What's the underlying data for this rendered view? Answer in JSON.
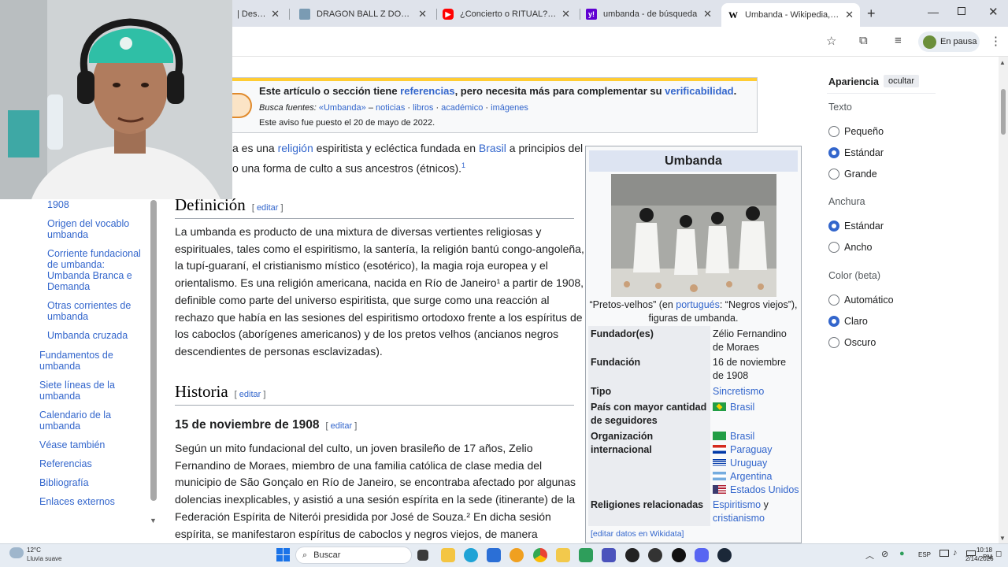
{
  "browser": {
    "tabs": [
      {
        "title": "| Descarg",
        "favicon_color": "#777777"
      },
      {
        "title": "DRAGON BALL Z DOKKAN",
        "favicon_color": "#7a9bb3"
      },
      {
        "title": "¿Concierto o RITUAL? Las s",
        "favicon_color": "#ff0000"
      },
      {
        "title": "umbanda - de búsqueda",
        "favicon_color": "#6001d2",
        "favicon_letter": "y!"
      },
      {
        "title": "Umbanda - Wikipedia, la e",
        "favicon_color": "#000000",
        "favicon_letter": "W"
      }
    ],
    "new_tab": "+",
    "profile_status": "En pausa"
  },
  "notice": {
    "line1_a": "Este artículo o sección tiene ",
    "line1_link1": "referencias",
    "line1_b": ", pero necesita más para complementar su ",
    "line1_link2": "verificabilidad",
    "line1_c": ".",
    "line2_prefix": "Busca fuentes:",
    "line2_links": [
      "«Umbanda»",
      "noticias",
      "libros",
      "académico",
      "imágenes"
    ],
    "line3": "Este aviso fue puesto el 20 de mayo de 2022."
  },
  "toc": {
    "items": [
      {
        "label": "1908"
      },
      {
        "label": "Origen del vocablo umbanda"
      },
      {
        "label": "Corriente fundacional de umbanda: Umbanda Branca e Demanda"
      },
      {
        "label": "Otras corrientes de umbanda"
      },
      {
        "label": "Umbanda cruzada"
      },
      {
        "label": "Fundamentos de umbanda"
      },
      {
        "label": "Siete líneas de la umbanda"
      },
      {
        "label": "Calendario de la umbanda"
      },
      {
        "label": "Véase también"
      },
      {
        "label": "Referencias"
      },
      {
        "label": "Bibliografía"
      },
      {
        "label": "Enlaces externos"
      }
    ]
  },
  "article": {
    "intro_l1_a": "a es una ",
    "intro_l1_link1": "religión",
    "intro_l1_b": " espiritista y ecléctica fundada en ",
    "intro_l1_link2": "Brasil",
    "intro_l1_c": " a principios del",
    "intro_l2": "o una forma de culto a sus ancestros (étnicos).",
    "intro_sup": "1",
    "h_definicion": "Definición",
    "edit": "editar",
    "def_lines": [
      "La umbanda es producto de una mixtura de diversas vertientes religiosas y",
      "espirituales, tales como el espiritismo, la santería, la religión bantú congo-angoleña,",
      "la tupí-guaraní, el cristianismo místico (esotérico), la magia roja europea y el",
      "orientalismo. Es una religión americana, nacida en Río de Janeiro¹  a partir de 1908,",
      "definible como parte del universo espiritista, que surge como una reacción al",
      "rechazo que había en las sesiones del espiritismo ortodoxo frente a los espíritus de",
      "los caboclos (aborígenes americanos) y de los pretos velhos (ancianos negros",
      "descendientes de personas esclavizadas)."
    ],
    "h_historia": "Historia",
    "h_fecha": "15 de noviembre de 1908",
    "hist_lines": [
      "Según un mito fundacional del culto, un joven brasileño de 17 años, Zelio",
      "Fernandino de Moraes, miembro de una familia católica de clase media del",
      "municipio de São Gonçalo en Río de Janeiro, se encontraba afectado por algunas",
      "dolencias inexplicables, y asistió a una sesión espírita en la sede (itinerante) de la",
      "Federación Espírita de Niterói presidida por José de Souza.²  En dicha sesión",
      "espírita, se manifestaron espíritus de caboclos y negros viejos, de manera"
    ]
  },
  "infobox": {
    "title": "Umbanda",
    "caption_a": "“Pretos-velhos” (en ",
    "caption_link": "portugués",
    "caption_b": ": “Negros viejos”),",
    "caption_c": "figuras de umbanda.",
    "rows": [
      {
        "label": "Fundador(es)",
        "value": "Zélio Fernandino de Moraes"
      },
      {
        "label": "Fundación",
        "value": "16 de noviembre de 1908"
      },
      {
        "label": "Tipo",
        "value": "Sincretismo"
      },
      {
        "label": "País con mayor cantidad de seguidores",
        "value": "Brasil"
      },
      {
        "label": "Organización internacional",
        "values": [
          "Brasil",
          "Paraguay",
          "Uruguay",
          "Argentina",
          "Estados Unidos"
        ]
      },
      {
        "label": "Religiones relacionadas",
        "value_a": "Espiritismo",
        "value_b": " y",
        "value_c": "cristianismo"
      }
    ],
    "footer": "[editar datos en Wikidata]"
  },
  "appearance": {
    "title": "Apariencia",
    "hide": "ocultar",
    "text_heading": "Texto",
    "text_options": [
      "Pequeño",
      "Estándar",
      "Grande"
    ],
    "text_selected": "Estándar",
    "width_heading": "Anchura",
    "width_options": [
      "Estándar",
      "Ancho"
    ],
    "width_selected": "Estándar",
    "color_heading": "Color (beta)",
    "color_options": [
      "Automático",
      "Claro",
      "Oscuro"
    ],
    "color_selected": "Claro"
  },
  "taskbar": {
    "weather_temp": "12°C",
    "weather_desc": "Lluvia suave",
    "search_placeholder": "Buscar",
    "lang": "ESP",
    "time": "10:18 PM",
    "date": "2/14/2026"
  }
}
